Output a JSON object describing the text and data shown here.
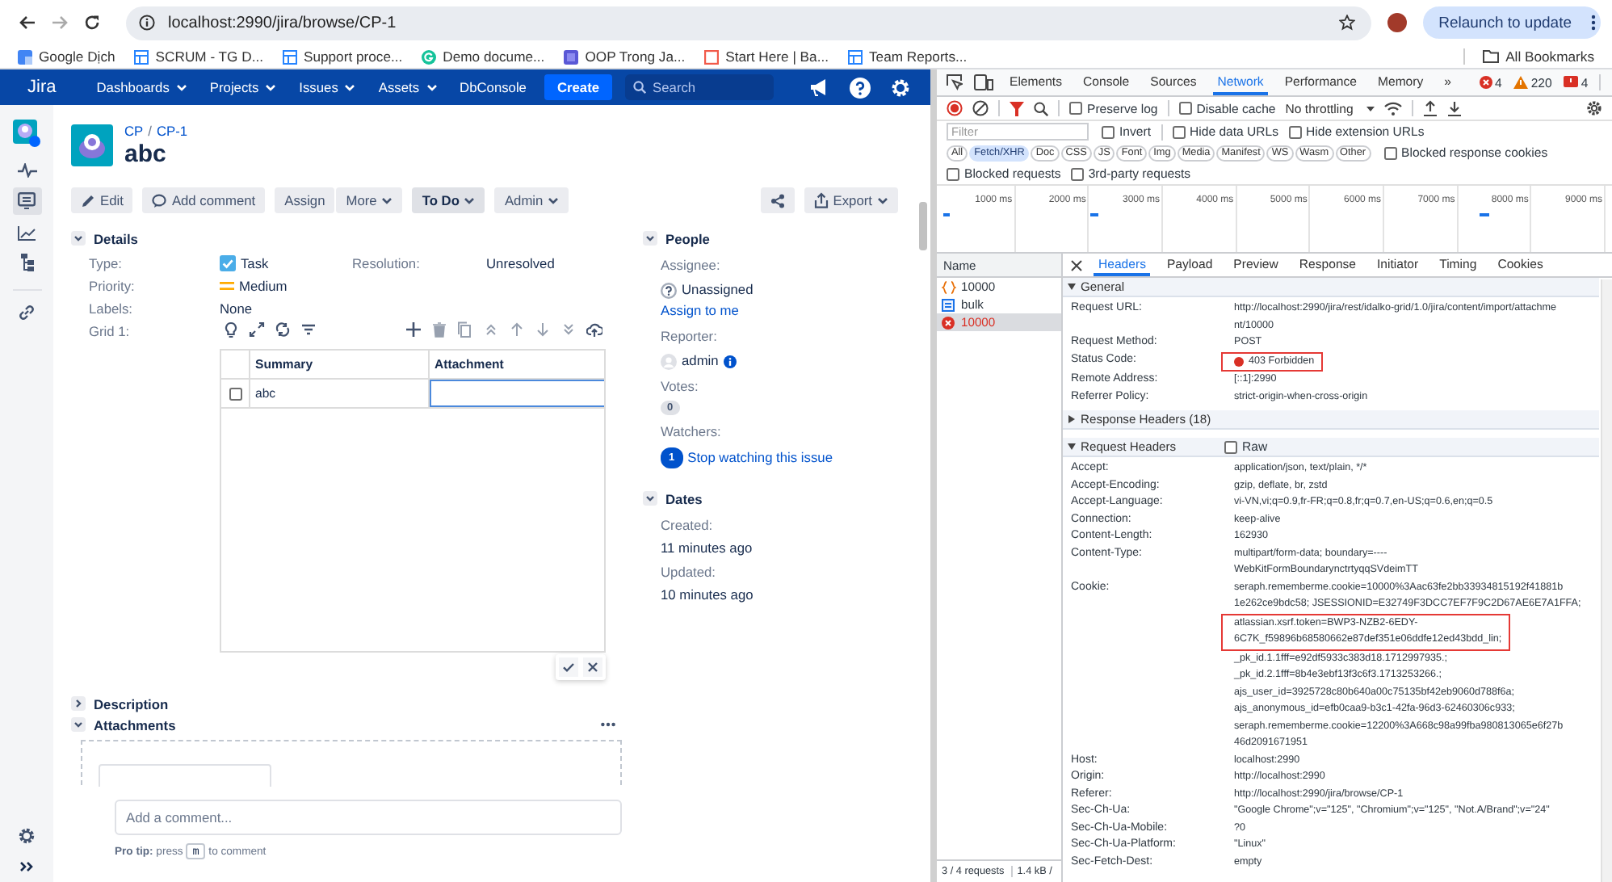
{
  "browser": {
    "url": "localhost:2990/jira/browse/CP-1",
    "relaunch_button": "Relaunch to update",
    "bookmarks": [
      {
        "label": "Google Dịch",
        "kind": "translate"
      },
      {
        "label": "SCRUM - TG D...",
        "kind": "board"
      },
      {
        "label": "Support proce...",
        "kind": "board"
      },
      {
        "label": "Demo docume...",
        "kind": "grammar"
      },
      {
        "label": "OOP Trong Ja...",
        "kind": "course"
      },
      {
        "label": "Start Here | Ba...",
        "kind": "page"
      },
      {
        "label": "Team Reports...",
        "kind": "board"
      }
    ],
    "all_bookmarks": "All Bookmarks"
  },
  "jira": {
    "nav": {
      "logo": "Jira",
      "menus": [
        {
          "label": "Dashboards",
          "dropdown": true
        },
        {
          "label": "Projects",
          "dropdown": true
        },
        {
          "label": "Issues",
          "dropdown": true
        },
        {
          "label": "Assets",
          "dropdown": true
        },
        {
          "label": "DbConsole",
          "dropdown": false
        }
      ],
      "create_button": "Create",
      "search": {
        "placeholder": "Search"
      }
    },
    "sidebar": {
      "items": [
        {
          "kind": "project",
          "selected": false
        },
        {
          "kind": "activity",
          "selected": false
        },
        {
          "kind": "board",
          "selected": true
        },
        {
          "kind": "reports",
          "selected": false
        },
        {
          "kind": "tree",
          "selected": false
        },
        {
          "kind": "link",
          "selected": false
        }
      ]
    },
    "breadcrumbs": [
      "CP",
      "CP-1"
    ],
    "breadcrumb_separator": "/",
    "title": "abc",
    "actions": [
      {
        "label": "Edit",
        "kind": "edit"
      },
      {
        "label": "Add comment",
        "kind": "comment"
      },
      {
        "label": "Assign",
        "kind": "plain"
      },
      {
        "label": "More",
        "kind": "menu"
      },
      {
        "label": "To Do",
        "kind": "status"
      },
      {
        "label": "Admin",
        "kind": "menu"
      }
    ],
    "export_button": "Export",
    "details": {
      "title": "Details",
      "expanded": true,
      "fields": [
        {
          "label": "Type:",
          "value": "Task",
          "kind": "type"
        },
        {
          "label": "Priority:",
          "value": "Medium",
          "kind": "priority"
        },
        {
          "label": "Labels:",
          "value": "None",
          "kind": "text"
        }
      ],
      "resolution": {
        "label": "Resolution:",
        "value": "Unresolved"
      },
      "grid": {
        "label": "Grid 1:",
        "columns": [
          "Summary",
          "Attachment"
        ],
        "rows": [
          {
            "cells": [
              "abc"
            ],
            "selected": false
          }
        ]
      }
    },
    "description": {
      "title": "Description",
      "expanded": false
    },
    "attachments": {
      "title": "Attachments",
      "expanded": true
    },
    "comment": {
      "placeholder": "Add a comment...",
      "tip_label": "Pro tip:",
      "tip_before": "press",
      "key": "m",
      "tip_after": "to comment"
    },
    "people": {
      "title": "People",
      "expanded": true,
      "assignee_label": "Assignee:",
      "assignee": "Unassigned",
      "assign_link": "Assign to me",
      "reporter_label": "Reporter:",
      "reporter": "admin",
      "votes_label": "Votes:",
      "votes": "0",
      "watchers_label": "Watchers:",
      "watchers": "1",
      "watch_link": "Stop watching this issue"
    },
    "dates": {
      "title": "Dates",
      "expanded": true,
      "created_label": "Created:",
      "created": "11 minutes ago",
      "updated_label": "Updated:",
      "updated": "10 minutes ago"
    }
  },
  "devtools": {
    "tabs": [
      {
        "label": "Elements",
        "selected": false
      },
      {
        "label": "Console",
        "selected": false
      },
      {
        "label": "Sources",
        "selected": false
      },
      {
        "label": "Network",
        "selected": true
      },
      {
        "label": "Performance",
        "selected": false
      },
      {
        "label": "Memory",
        "selected": false
      }
    ],
    "more_tabs": "»",
    "errors": "4",
    "warnings": "220",
    "issues": "4",
    "preserve_log": {
      "label": "Preserve log",
      "checked": false
    },
    "disable_cache": {
      "label": "Disable cache",
      "checked": false
    },
    "throttling": "No throttling",
    "filter": {
      "placeholder": "Filter"
    },
    "filter_options": [
      {
        "label": "Invert",
        "checked": false
      },
      {
        "label": "Hide data URLs",
        "checked": false
      },
      {
        "label": "Hide extension URLs",
        "checked": false
      }
    ],
    "types": [
      {
        "label": "All",
        "selected": false
      },
      {
        "label": "Fetch/XHR",
        "selected": true
      },
      {
        "label": "Doc",
        "selected": false
      },
      {
        "label": "CSS",
        "selected": false
      },
      {
        "label": "JS",
        "selected": false
      },
      {
        "label": "Font",
        "selected": false
      },
      {
        "label": "Img",
        "selected": false
      },
      {
        "label": "Media",
        "selected": false
      },
      {
        "label": "Manifest",
        "selected": false
      },
      {
        "label": "WS",
        "selected": false
      },
      {
        "label": "Wasm",
        "selected": false
      },
      {
        "label": "Other",
        "selected": false
      }
    ],
    "blocked_cookies": {
      "label": "Blocked response cookies",
      "checked": false
    },
    "blocked_options": [
      {
        "label": "Blocked requests",
        "checked": false
      },
      {
        "label": "3rd-party requests",
        "checked": false
      }
    ],
    "timeline": {
      "ticks": [
        "1000 ms",
        "2000 ms",
        "3000 ms",
        "4000 ms",
        "5000 ms",
        "6000 ms",
        "7000 ms",
        "8000 ms",
        "9000 ms"
      ]
    },
    "requests": {
      "header": "Name",
      "items": [
        {
          "name": "10000",
          "kind": "fetch",
          "selected": false
        },
        {
          "name": "bulk",
          "kind": "doc",
          "selected": false
        },
        {
          "name": "10000",
          "kind": "error",
          "selected": true
        }
      ]
    },
    "detail_tabs": [
      {
        "label": "Headers",
        "selected": true
      },
      {
        "label": "Payload",
        "selected": false
      },
      {
        "label": "Preview",
        "selected": false
      },
      {
        "label": "Response",
        "selected": false
      },
      {
        "label": "Initiator",
        "selected": false
      },
      {
        "label": "Timing",
        "selected": false
      },
      {
        "label": "Cookies",
        "selected": false
      }
    ],
    "general": {
      "title": "General",
      "expanded": true,
      "rows": [
        {
          "name": "Request URL:",
          "lines": [
            {
              "text": "http://localhost:2990/jira/rest/idalko-grid/1.0/jira/content/import/attachme",
              "highlighted": false
            },
            {
              "text": "nt/10000",
              "highlighted": false
            }
          ]
        },
        {
          "name": "Request Method:",
          "lines": [
            {
              "text": "POST",
              "highlighted": false
            }
          ]
        },
        {
          "name": "Status Code:",
          "color": "#d93025",
          "lines": [
            {
              "text": "403 Forbidden",
              "highlighted": true
            }
          ]
        },
        {
          "name": "Remote Address:",
          "lines": [
            {
              "text": "[::1]:2990",
              "highlighted": false
            }
          ]
        },
        {
          "name": "Referrer Policy:",
          "lines": [
            {
              "text": "strict-origin-when-cross-origin",
              "highlighted": false
            }
          ]
        }
      ]
    },
    "response_headers": {
      "title": "Response Headers (18)",
      "expanded": false
    },
    "request_headers": {
      "title": "Request Headers",
      "expanded": true,
      "raw": {
        "label": "Raw",
        "checked": false
      },
      "rows": [
        {
          "name": "Accept:",
          "lines": [
            {
              "text": "application/json, text/plain, */*",
              "highlighted": false
            }
          ]
        },
        {
          "name": "Accept-Encoding:",
          "lines": [
            {
              "text": "gzip, deflate, br, zstd",
              "highlighted": false
            }
          ]
        },
        {
          "name": "Accept-Language:",
          "lines": [
            {
              "text": "vi-VN,vi;q=0.9,fr-FR;q=0.8,fr;q=0.7,en-US;q=0.6,en;q=0.5",
              "highlighted": false
            }
          ]
        },
        {
          "name": "Connection:",
          "lines": [
            {
              "text": "keep-alive",
              "highlighted": false
            }
          ]
        },
        {
          "name": "Content-Length:",
          "lines": [
            {
              "text": "162930",
              "highlighted": false
            }
          ]
        },
        {
          "name": "Content-Type:",
          "lines": [
            {
              "text": "multipart/form-data; boundary=----",
              "highlighted": false
            },
            {
              "text": "WebKitFormBoundarynctrtyqqSVdeimTT",
              "highlighted": false
            }
          ]
        },
        {
          "name": "Cookie:",
          "lines": [
            {
              "text": "seraph.rememberme.cookie=10000%3Aac63fe2bb33934815192f41881b",
              "highlighted": false
            },
            {
              "text": "1e262ce9bdc58; JSESSIONID=E32749F3DCC7EF7F9C2D67AE6E7A1FFA;",
              "highlighted": false
            },
            {
              "text": "atlassian.xsrf.token=BWP3-NZB2-6EDY-",
              "highlighted": true
            },
            {
              "text": "6C7K_f59896b68580662e87def351e06ddfe12ed43bdd_lin;",
              "highlighted": true
            },
            {
              "text": "_pk_id.1.1fff=e92df5933c383d18.1712997935.;",
              "highlighted": false
            },
            {
              "text": "_pk_id.2.1fff=8b4e3ebf13f3c6f3.1713253266.;",
              "highlighted": false
            },
            {
              "text": "ajs_user_id=3925728c80b640a00c75135bf42eb9060d788f6a;",
              "highlighted": false
            },
            {
              "text": "ajs_anonymous_id=efb0caa9-b3c1-42fa-96d3-62460306c933;",
              "highlighted": false
            },
            {
              "text": "seraph.rememberme.cookie=12200%3A668c98a99fba980813065e6f27b",
              "highlighted": false
            },
            {
              "text": "46d2091671951",
              "highlighted": false
            }
          ]
        },
        {
          "name": "Host:",
          "lines": [
            {
              "text": "localhost:2990",
              "highlighted": false
            }
          ]
        },
        {
          "name": "Origin:",
          "lines": [
            {
              "text": "http://localhost:2990",
              "highlighted": false
            }
          ]
        },
        {
          "name": "Referer:",
          "lines": [
            {
              "text": "http://localhost:2990/jira/browse/CP-1",
              "highlighted": false
            }
          ]
        },
        {
          "name": "Sec-Ch-Ua:",
          "lines": [
            {
              "text": "\"Google Chrome\";v=\"125\", \"Chromium\";v=\"125\", \"Not.A/Brand\";v=\"24\"",
              "highlighted": false
            }
          ]
        },
        {
          "name": "Sec-Ch-Ua-Mobile:",
          "lines": [
            {
              "text": "?0",
              "highlighted": false
            }
          ]
        },
        {
          "name": "Sec-Ch-Ua-Platform:",
          "lines": [
            {
              "text": "\"Linux\"",
              "highlighted": false
            }
          ]
        },
        {
          "name": "Sec-Fetch-Dest:",
          "lines": [
            {
              "text": "empty",
              "highlighted": false
            }
          ]
        }
      ]
    },
    "status_bar": {
      "requests": "3 / 4 requests",
      "size": "1.4 kB /"
    }
  }
}
